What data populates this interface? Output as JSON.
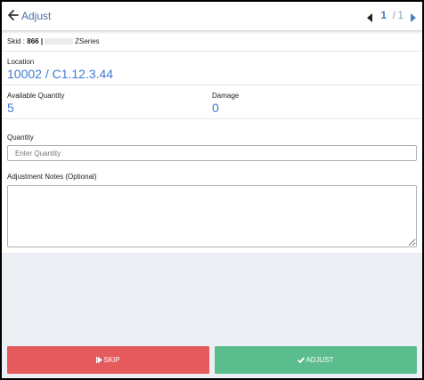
{
  "header": {
    "title": "Adjust",
    "pager": {
      "current": "1",
      "separator": "/",
      "total": "1"
    }
  },
  "skid": {
    "label": "Skid :",
    "number": "866",
    "divider": "|",
    "series": "ZSeries"
  },
  "location": {
    "label": "Location",
    "value": "10002 / C1.12.3.44"
  },
  "available_quantity": {
    "label": "Available Quantity",
    "value": "5"
  },
  "damage": {
    "label": "Damage",
    "value": "0"
  },
  "quantity": {
    "label": "Quantity",
    "placeholder": "Enter Quantity",
    "value": ""
  },
  "notes": {
    "label": "Adjustment Notes (Optional)",
    "value": ""
  },
  "actions": {
    "skip_label": "SKIP",
    "adjust_label": "ADJUST"
  },
  "colors": {
    "accent": "#3d7ad6",
    "skip": "#e55a5c",
    "adjust": "#5bbd8d",
    "title": "#4a6fa5"
  },
  "icons": {
    "back": "arrow-left-icon",
    "prev": "caret-left-icon",
    "next": "caret-right-icon",
    "skip": "step-forward-icon",
    "adjust": "check-icon"
  }
}
